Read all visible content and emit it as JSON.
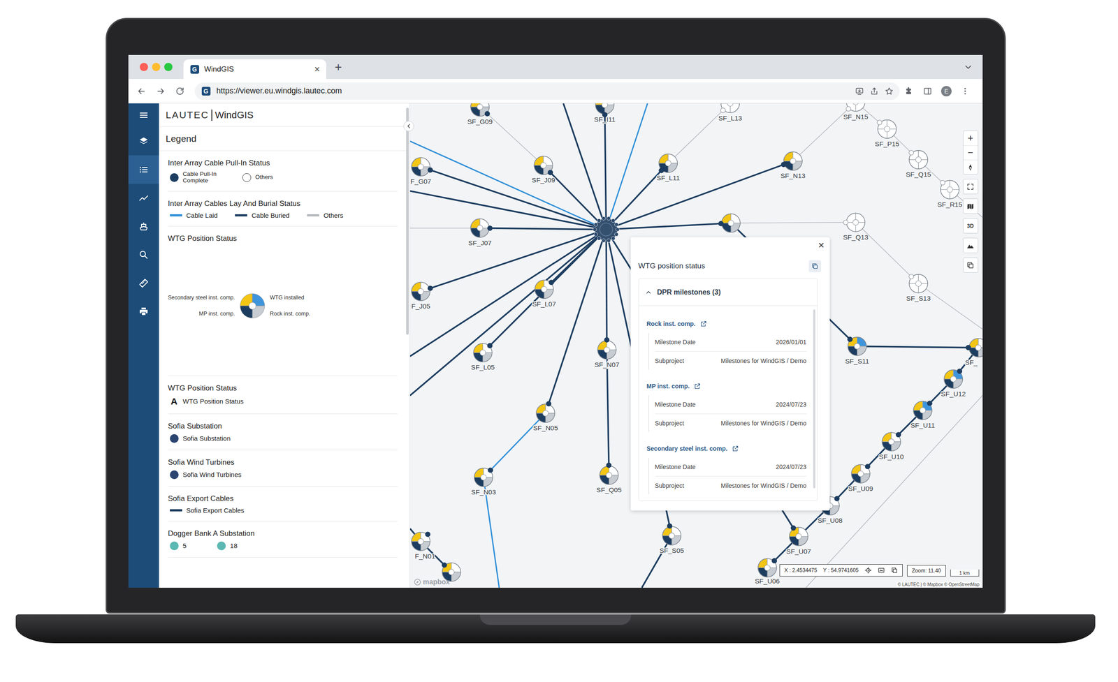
{
  "browser": {
    "tabs": [
      {
        "label": "WindGIS",
        "selected": true,
        "favicon": "G",
        "close": "×"
      }
    ],
    "new_tab": "+",
    "url": "https://viewer.eu.windgis.lautec.com",
    "url_favicon": "G",
    "profile": "E"
  },
  "app": {
    "brand": {
      "company": "LAUTEC",
      "product": "WindGIS"
    },
    "rail": [
      {
        "selected": false
      },
      {
        "selected": false
      },
      {
        "selected": true
      },
      {
        "selected": false
      },
      {
        "selected": false
      },
      {
        "selected": false
      },
      {
        "selected": false
      },
      {
        "selected": false
      }
    ],
    "legend": {
      "title": "Legend",
      "sections": [
        {
          "title": "Inter Array Cable Pull-In Status",
          "kind": "symbols",
          "items": [
            {
              "kind": "dot",
              "label": "Cable Pull-In Complete",
              "color": "#1d3d60"
            },
            {
              "kind": "ring",
              "label": "Others",
              "color": "#333333"
            }
          ]
        },
        {
          "title": "Inter Array Cables Lay And Burial Status",
          "kind": "symbols",
          "items": [
            {
              "kind": "line",
              "label": "Cable Laid",
              "color": "#2f8fd8"
            },
            {
              "kind": "line",
              "label": "Cable Buried",
              "color": "#1d3d60"
            },
            {
              "kind": "line",
              "label": "Others",
              "color": "#b4b8bd"
            }
          ]
        },
        {
          "title": "WTG Position Status",
          "kind": "pie",
          "items": [
            {
              "label": "Secondary steel inst. comp.",
              "color": "#f3c515"
            },
            {
              "label": "WTG installed",
              "color": "#3f95dc"
            },
            {
              "label": "MP inst. comp.",
              "color": "#1d3d60"
            },
            {
              "label": "Rock inst. comp.",
              "color": "#c7ccd2"
            }
          ]
        },
        {
          "title": "WTG Position Status",
          "kind": "symbols",
          "items": [
            {
              "kind": "text-symbol",
              "symbol": "A",
              "label": "WTG Position Status"
            }
          ]
        },
        {
          "title": "Sofia Substation",
          "kind": "symbols",
          "items": [
            {
              "kind": "dot",
              "label": "Sofia Substation",
              "color": "#2b4570"
            }
          ]
        },
        {
          "title": "Sofia Wind Turbines",
          "kind": "symbols",
          "items": [
            {
              "kind": "dot",
              "label": "Sofia Wind Turbines",
              "color": "#2b4570"
            }
          ]
        },
        {
          "title": "Sofia Export Cables",
          "kind": "symbols",
          "items": [
            {
              "kind": "line",
              "label": "Sofia Export Cables",
              "color": "#1d3d60"
            }
          ]
        },
        {
          "title": "Dogger Bank A Substation",
          "kind": "symbols",
          "items": [
            {
              "kind": "dot",
              "label": "5",
              "color": "#5cb8b2"
            },
            {
              "kind": "dot",
              "label": "18",
              "color": "#5cb8b2"
            }
          ]
        }
      ]
    }
  },
  "map": {
    "turbines": [
      {
        "label": "SF_G09",
        "steel": true,
        "wtg": false,
        "mp": true,
        "rock": true,
        "pull_in": true
      },
      {
        "label": "SF_I11",
        "steel": true,
        "wtg": false,
        "mp": true,
        "rock": true,
        "pull_in": true
      },
      {
        "label": "SF_L13",
        "steel": false,
        "wtg": false,
        "mp": false,
        "rock": false,
        "pull_in": false
      },
      {
        "label": "SF_N15",
        "steel": false,
        "wtg": false,
        "mp": false,
        "rock": false,
        "pull_in": false
      },
      {
        "label": "SF_P15",
        "steel": false,
        "wtg": false,
        "mp": false,
        "rock": false,
        "pull_in": false
      },
      {
        "label": "SF_Q15",
        "steel": false,
        "wtg": false,
        "mp": false,
        "rock": false,
        "pull_in": false
      },
      {
        "label": "SF_R15",
        "steel": false,
        "wtg": false,
        "mp": false,
        "rock": false,
        "pull_in": false
      },
      {
        "label": "F_G07",
        "steel": true,
        "wtg": false,
        "mp": true,
        "rock": true,
        "pull_in": true
      },
      {
        "label": "SF_J09",
        "steel": true,
        "wtg": false,
        "mp": true,
        "rock": true,
        "pull_in": true
      },
      {
        "label": "SF_L11",
        "steel": true,
        "wtg": false,
        "mp": true,
        "rock": true,
        "pull_in": true
      },
      {
        "label": "SF_N13",
        "steel": true,
        "wtg": false,
        "mp": true,
        "rock": true,
        "pull_in": true
      },
      {
        "label": "SF_J07",
        "steel": true,
        "wtg": false,
        "mp": true,
        "rock": true,
        "pull_in": true
      },
      {
        "steel": true,
        "wtg": false,
        "mp": true,
        "rock": true,
        "pull_in": true
      },
      {
        "label": "SF_Q13",
        "steel": false,
        "wtg": false,
        "mp": false,
        "rock": false,
        "pull_in": false
      },
      {
        "label": "SF_S13",
        "steel": false,
        "wtg": false,
        "mp": false,
        "rock": false,
        "pull_in": false
      },
      {
        "label": "F_J05",
        "steel": true,
        "wtg": false,
        "mp": true,
        "rock": true,
        "pull_in": true
      },
      {
        "label": "SF_L07",
        "steel": true,
        "wtg": false,
        "mp": true,
        "rock": true,
        "pull_in": true
      },
      {
        "label": "SF_L05",
        "steel": true,
        "wtg": false,
        "mp": true,
        "rock": true,
        "pull_in": true
      },
      {
        "label": "SF_N07",
        "steel": true,
        "wtg": false,
        "mp": true,
        "rock": true,
        "pull_in": true
      },
      {
        "label": "SF_N05",
        "steel": true,
        "wtg": false,
        "mp": true,
        "rock": true,
        "pull_in": true
      },
      {
        "label": "SF_N03",
        "steel": true,
        "wtg": false,
        "mp": true,
        "rock": true,
        "pull_in": true
      },
      {
        "label": "SF_Q05",
        "steel": true,
        "wtg": false,
        "mp": true,
        "rock": true,
        "pull_in": true
      },
      {
        "label": "F_N01",
        "steel": true,
        "wtg": false,
        "mp": true,
        "rock": true,
        "pull_in": true
      },
      {
        "steel": true,
        "wtg": false,
        "mp": true,
        "rock": true,
        "pull_in": true
      },
      {
        "label": "SF_S05",
        "steel": true,
        "wtg": false,
        "mp": true,
        "rock": true,
        "pull_in": true
      },
      {
        "label": "SF_S11",
        "steel": true,
        "wtg": true,
        "mp": true,
        "rock": true,
        "pull_in": true
      },
      {
        "label": "SF_",
        "steel": true,
        "wtg": false,
        "mp": true,
        "rock": true,
        "pull_in": true
      },
      {
        "label": "SF_U12",
        "steel": true,
        "wtg": true,
        "mp": true,
        "rock": true,
        "pull_in": true
      },
      {
        "label": "SF_U11",
        "steel": true,
        "wtg": true,
        "mp": true,
        "rock": true,
        "pull_in": true
      },
      {
        "label": "SF_U10",
        "steel": true,
        "wtg": false,
        "mp": true,
        "rock": true,
        "pull_in": true
      },
      {
        "label": "SF_U09",
        "steel": true,
        "wtg": false,
        "mp": true,
        "rock": true,
        "pull_in": true
      },
      {
        "label": "SF_U08",
        "steel": true,
        "wtg": false,
        "mp": true,
        "rock": true,
        "pull_in": true
      },
      {
        "label": "SF_U07",
        "steel": true,
        "wtg": false,
        "mp": true,
        "rock": true,
        "pull_in": true
      },
      {
        "label": "SF_U06",
        "steel": true,
        "wtg": false,
        "mp": true,
        "rock": true,
        "pull_in": true
      }
    ],
    "cables": [
      {
        "status": "laid"
      },
      {
        "status": "buried"
      },
      {
        "status": "others"
      },
      {
        "status": "buried"
      },
      {
        "status": "buried"
      },
      {
        "status": "buried"
      },
      {
        "status": "laid"
      },
      {
        "status": "buried"
      },
      {
        "status": "buried"
      },
      {
        "status": "buried"
      },
      {
        "status": "buried"
      },
      {
        "status": "buried"
      },
      {
        "status": "buried"
      },
      {
        "status": "buried"
      },
      {
        "status": "buried"
      },
      {
        "status": "buried"
      },
      {
        "status": "buried"
      },
      {
        "status": "buried"
      },
      {
        "status": "buried"
      },
      {
        "status": "buried"
      },
      {
        "status": "laid"
      },
      {
        "status": "laid"
      },
      {
        "status": "buried"
      },
      {
        "status": "buried"
      },
      {
        "status": "buried"
      },
      {
        "status": "buried"
      },
      {
        "status": "buried"
      },
      {
        "status": "buried"
      },
      {
        "status": "buried"
      },
      {
        "status": "buried"
      },
      {
        "status": "buried"
      },
      {
        "status": "buried"
      },
      {
        "status": "buried"
      },
      {
        "status": "buried"
      },
      {
        "status": "others"
      },
      {
        "status": "others"
      },
      {
        "status": "others"
      },
      {
        "status": "others"
      },
      {
        "status": "others"
      },
      {
        "status": "others"
      },
      {
        "status": "others"
      },
      {
        "status": "others"
      },
      {
        "status": "others"
      },
      {
        "status": "others"
      },
      {
        "status": "buried"
      },
      {
        "status": "buried"
      },
      {
        "status": "others"
      }
    ],
    "controls": [
      {
        "kind": "zoom-in",
        "text": "+"
      },
      {
        "kind": "zoom-out",
        "text": "−"
      },
      {
        "kind": "compass"
      },
      {
        "kind": "fullscreen"
      },
      {
        "kind": "basemap"
      },
      {
        "kind": "3d",
        "text": "3D"
      },
      {
        "kind": "terrain"
      },
      {
        "kind": "copy"
      }
    ],
    "coordinates": {
      "x": "X : 2.4534475",
      "y": "Y : 54.9741605"
    },
    "zoom": "Zoom: 11.40",
    "scale": "1 km",
    "attribution": "© LAUTEC | © Mapbox © OpenStreetMap",
    "logo": "mapbox"
  },
  "popup": {
    "title": "WTG position status",
    "close": "×",
    "group": {
      "label": "DPR milestones (3)",
      "expanded": true,
      "items": [
        {
          "name": "Rock inst. comp.",
          "rows": [
            {
              "label": "Milestone Date",
              "value": "2026/01/01"
            },
            {
              "label": "Subproject",
              "value": "Milestones for WindGIS / Demo"
            }
          ]
        },
        {
          "name": "MP inst. comp.",
          "rows": [
            {
              "label": "Milestone Date",
              "value": "2024/07/23"
            },
            {
              "label": "Subproject",
              "value": "Milestones for WindGIS / Demo"
            }
          ]
        },
        {
          "name": "Secondary steel inst. comp.",
          "rows": [
            {
              "label": "Milestone Date",
              "value": "2024/07/23"
            },
            {
              "label": "Subproject",
              "value": "Milestones for WindGIS / Demo"
            }
          ]
        }
      ]
    }
  }
}
